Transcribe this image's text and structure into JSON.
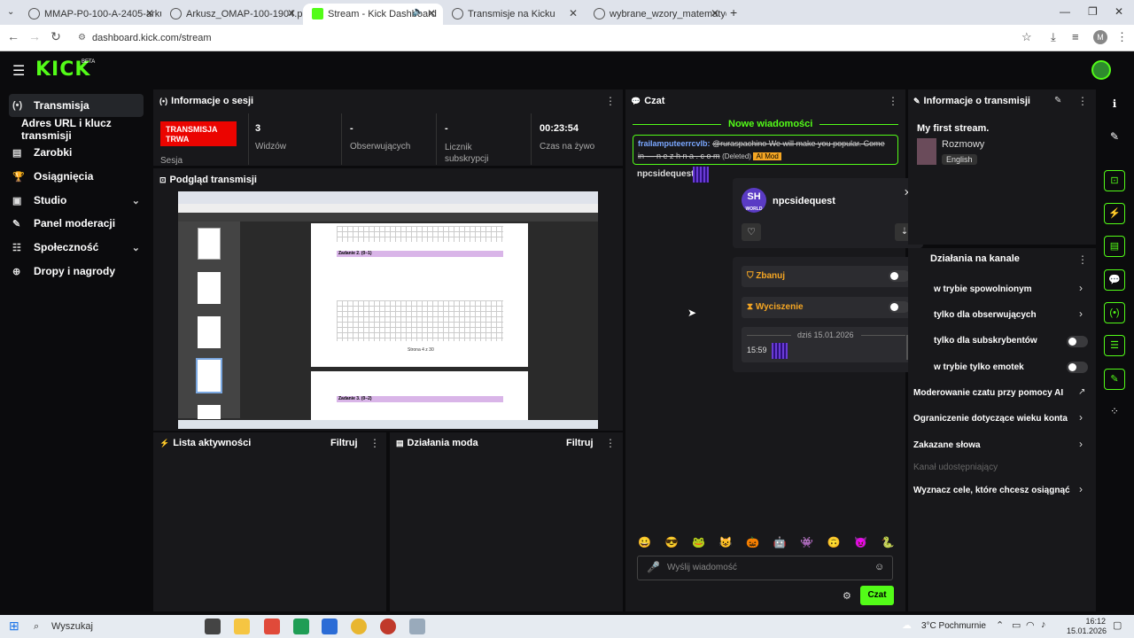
{
  "browser": {
    "tabs": [
      {
        "label": "MMAP-P0-100-A-2405-arkusz.p"
      },
      {
        "label": "Arkusz_OMAP-100-1904.pdf"
      },
      {
        "label": "Stream - Kick Dashboard"
      },
      {
        "label": "Transmisje na Kicku"
      },
      {
        "label": "wybrane_wzory_matematyczne"
      }
    ],
    "url": "dashboard.kick.com/stream",
    "profile_initial": "M"
  },
  "kick": {
    "logo": "KICK",
    "beta": "BETA"
  },
  "sidebar": {
    "items": [
      {
        "label": "Transmisja",
        "icon": "(•)"
      },
      {
        "label": "Adres URL i klucz transmisji",
        "icon": ""
      },
      {
        "label": "Zarobki",
        "icon": "▤"
      },
      {
        "label": "Osiągnięcia",
        "icon": "🏆"
      },
      {
        "label": "Studio",
        "icon": "▣"
      },
      {
        "label": "Panel moderacji",
        "icon": "✎"
      },
      {
        "label": "Społeczność",
        "icon": "☷"
      },
      {
        "label": "Dropy i nagrody",
        "icon": "⊕"
      }
    ]
  },
  "session": {
    "title": "Informacje o sesji",
    "live_badge": "TRANSMISJA TRWA",
    "session_label": "Sesja",
    "stats": [
      {
        "value": "3",
        "label": "Widzów"
      },
      {
        "value": "-",
        "label": "Obserwujących"
      },
      {
        "value": "-",
        "label": "Licznik subskrypcji"
      },
      {
        "value": "00:23:54",
        "label": "Czas na żywo"
      }
    ]
  },
  "preview": {
    "title": "Podgląd transmisji",
    "page_label": "Strona 4 z 30",
    "task2": "Zadanie 2. (0–1)",
    "task3": "Zadanie 3. (0–2)"
  },
  "activity": {
    "title": "Lista aktywności",
    "filter": "Filtruj"
  },
  "modactions": {
    "title": "Działania moda",
    "filter": "Filtruj"
  },
  "chat": {
    "title": "Czat",
    "new_messages": "Nowe wiadomości",
    "msg1_user": "fraiIamputeerrcvlb:",
    "msg1_text": "@ruraspachino We will make you popular. Come in — n e z h n a . c o m",
    "msg1_deleted": "(Deleted)",
    "msg1_badge": "AI Mod",
    "msg2_user": "npcsidequest:",
    "input_placeholder": "Wyślij wiadomość",
    "send": "Czat",
    "emotes": [
      "😀",
      "😎",
      "🐸",
      "😺",
      "🎃",
      "🤖",
      "👾",
      "🙃",
      "😈",
      "🐍"
    ]
  },
  "usercard": {
    "avatar_text": "SH",
    "avatar_sub": "WORLD",
    "username": "npcsidequest",
    "ban": "Zbanuj",
    "mute": "Wyciszenie",
    "date": "dziś 15.01.2026",
    "time": "15:59"
  },
  "streaminfo": {
    "title": "Informacje o transmisji",
    "stream_title": "My first stream.",
    "category": "Rozmowy",
    "language": "English"
  },
  "channel": {
    "title": "Działania na kanale",
    "items": [
      {
        "label": "w trybie spowolnionym",
        "kind": "chevron"
      },
      {
        "label": "tylko dla obserwujących",
        "kind": "chevron"
      },
      {
        "label": "tylko dla subskrybentów",
        "kind": "toggle"
      },
      {
        "label": "w trybie tylko emotek",
        "kind": "toggle"
      }
    ],
    "ai_mod": "Moderowanie czatu przy pomocy AI",
    "age_limit": "Ograniczenie dotyczące wieku konta",
    "banned_words": "Zakazane słowa",
    "sharing": "Kanał udostępniający",
    "goals": "Wyznacz cele, które chcesz osiągnąć"
  },
  "taskbar": {
    "search": "Wyszukaj",
    "weather": "3°C Pochmurnie",
    "time": "16:12",
    "date": "15.01.2026"
  },
  "colors": {
    "accent": "#53fc18",
    "live": "#eb0400",
    "panel": "#18181b"
  }
}
